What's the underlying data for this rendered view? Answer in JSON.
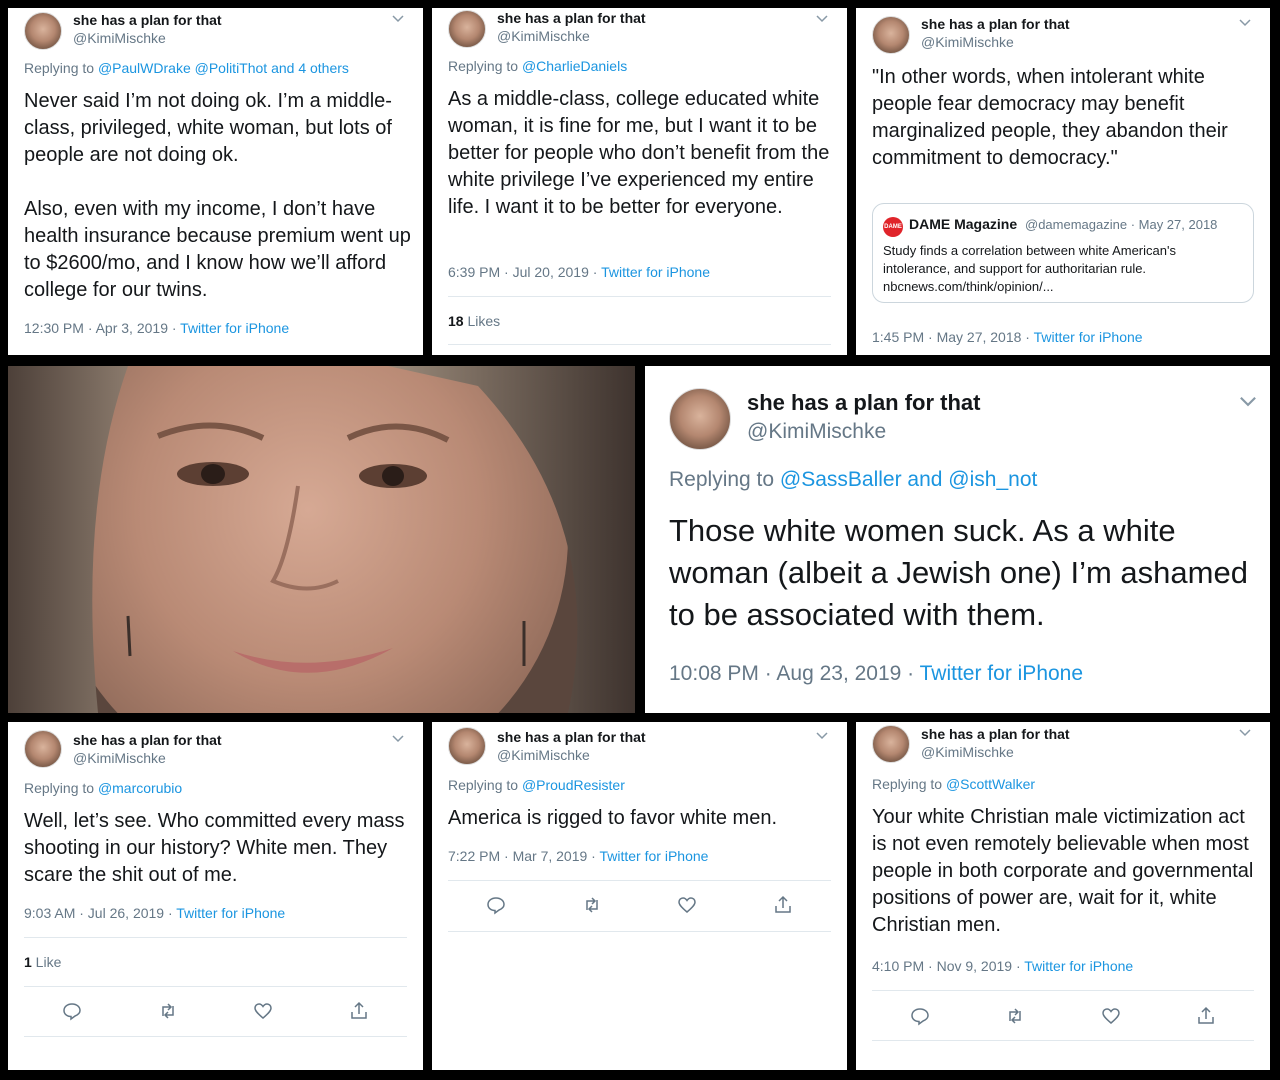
{
  "author": {
    "name": "she has a plan for that",
    "handle": "@KimiMischke"
  },
  "tweets": {
    "t1": {
      "reply_prefix": "Replying to ",
      "reply_to": "@PaulWDrake @PolitiThot and 4 others",
      "text": "Never said I’m not doing ok. I’m a middle-class, privileged, white woman, but lots of people are not doing ok.",
      "text2": "Also, even with my income, I don’t have health insurance because premium went up to $2600/mo, and I know how we’ll afford college for our twins.",
      "time": "12:30 PM · Apr 3, 2019 · ",
      "source": "Twitter for iPhone"
    },
    "t2": {
      "reply_prefix": "Replying to ",
      "reply_to": "@CharlieDaniels",
      "text": "As a middle-class, college educated white woman, it is fine for me, but I want it to be better for people who don’t benefit from the white privilege I’ve experienced my entire life. I want it to be better for everyone.",
      "time": "6:39 PM · Jul 20, 2019 · ",
      "source": "Twitter for iPhone",
      "likes_count": "18",
      "likes_label": " Likes"
    },
    "t3": {
      "text": "\"In other words, when intolerant white people fear democracy may benefit marginalized people, they abandon their commitment to democracy.\"",
      "card": {
        "logo_text": "DAME",
        "name": "DAME Magazine",
        "handle_date": "@damemagazine · May 27, 2018",
        "text": "Study finds a correlation between white American's intolerance, and support for authoritarian rule. nbcnews.com/think/opinion/..."
      },
      "time": "1:45 PM · May 27, 2018 · ",
      "source": "Twitter for iPhone"
    },
    "t4": {
      "reply_prefix": "Replying to ",
      "reply_to": "@SassBaller and @ish_not",
      "text": "Those white women suck. As a white woman (albeit a Jewish one) I’m ashamed to be associated with them.",
      "time": "10:08 PM · Aug 23, 2019 · ",
      "source": "Twitter for iPhone"
    },
    "t5": {
      "reply_prefix": "Replying to ",
      "reply_to": "@marcorubio",
      "text": "Well, let’s see. Who committed every mass shooting in our history? White men. They scare the shit out of me.",
      "time": "9:03 AM · Jul 26, 2019 · ",
      "source": "Twitter for iPhone",
      "likes_count": "1",
      "likes_label": " Like"
    },
    "t6": {
      "reply_prefix": "Replying to ",
      "reply_to": "@ProudResister",
      "text": "America is rigged to favor white men.",
      "time": "7:22 PM · Mar 7, 2019 · ",
      "source": "Twitter for iPhone"
    },
    "t7": {
      "reply_prefix": "Replying to ",
      "reply_to": "@ScottWalker",
      "text": "Your white Christian male victimization act is not even remotely believable when most people in both corporate and governmental positions of power are, wait for it, white Christian men.",
      "time": "4:10 PM · Nov 9, 2019 · ",
      "source": "Twitter for iPhone"
    }
  },
  "icons": [
    "reply-icon",
    "retweet-icon",
    "like-icon",
    "share-icon",
    "chevron-down-icon"
  ],
  "colors": {
    "link": "#1b95e0",
    "secondary": "#657786",
    "text": "#14171a",
    "divider": "#e1e8ed"
  }
}
